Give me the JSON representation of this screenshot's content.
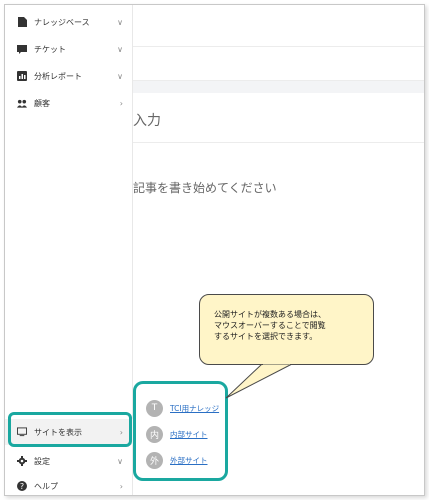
{
  "sidebar": {
    "items": [
      {
        "label": "ナレッジベース",
        "icon": "document-icon",
        "chevron": "∨"
      },
      {
        "label": "チケット",
        "icon": "ticket-icon",
        "chevron": "∨"
      },
      {
        "label": "分析レポート",
        "icon": "report-icon",
        "chevron": "∨"
      },
      {
        "label": "顧客",
        "icon": "people-icon",
        "chevron": "›"
      },
      {
        "label": "サイトを表示",
        "icon": "monitor-icon",
        "chevron": "›"
      },
      {
        "label": "設定",
        "icon": "gear-icon",
        "chevron": "∨"
      },
      {
        "label": "ヘルプ",
        "icon": "help-icon",
        "chevron": "›"
      }
    ]
  },
  "editor": {
    "title_placeholder": "入力",
    "body_placeholder": "記事を書き始めてください"
  },
  "site_popup": {
    "items": [
      {
        "initial": "T",
        "label": "TCI用ナレッジ"
      },
      {
        "initial": "内",
        "label": "内部サイト"
      },
      {
        "initial": "外",
        "label": "外部サイト"
      }
    ]
  },
  "callout": {
    "line1": "公開サイトが複数ある場合は、",
    "line2": "マウスオーバーすることで閲覧",
    "line3": "するサイトを選択できます。"
  },
  "colors": {
    "highlight": "#1aa8a0",
    "callout_bg": "#fff5c8",
    "link": "#2a6fc4"
  }
}
